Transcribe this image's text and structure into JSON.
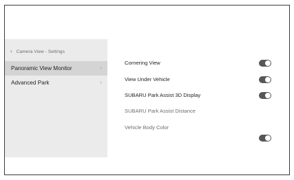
{
  "sidebar": {
    "header": "Camera View - Settings",
    "items": [
      {
        "label": "Panoramic View Monitor",
        "chevron": "›"
      },
      {
        "label": "Advanced Park",
        "chevron": "›"
      }
    ]
  },
  "settings": [
    {
      "label": "Cornering View",
      "toggle": "on"
    },
    {
      "label": "View Under Vehicle",
      "toggle": "on"
    },
    {
      "label": "SUBARU Park Assist 3D Display",
      "toggle": "on"
    },
    {
      "label": "SUBARU Park Assist Distance"
    },
    {
      "label": "Vehicle Body Color",
      "toggle": "on"
    }
  ],
  "colors": {
    "toggle_track": "#575757",
    "sidebar_bg": "#ebebeb",
    "sidebar_selected_bg": "#d4d4d4"
  }
}
